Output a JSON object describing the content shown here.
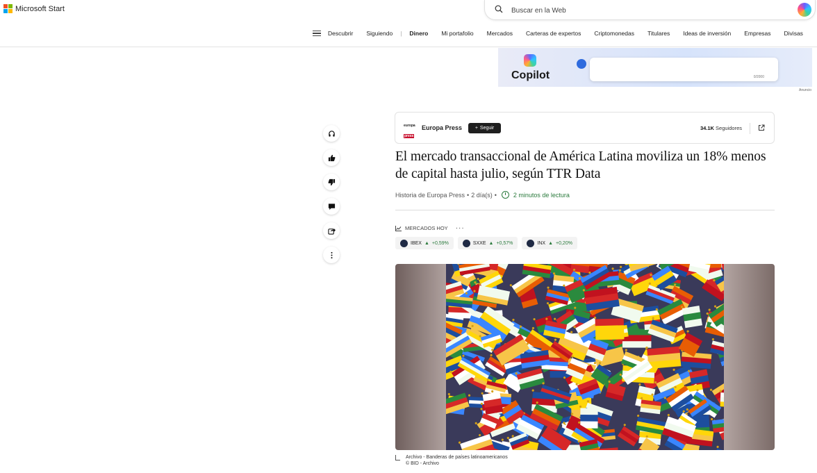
{
  "brand": {
    "name": "Microsoft Start"
  },
  "search": {
    "placeholder": "Buscar en la Web"
  },
  "nav": {
    "items": [
      "Descubrir",
      "Siguiendo",
      "Dinero",
      "Mi portafolio",
      "Mercados",
      "Carteras de expertos",
      "Criptomonedas",
      "Titulares",
      "Ideas de inversión",
      "Empresas",
      "Divisas"
    ],
    "active": "Dinero"
  },
  "ad": {
    "product": "Copilot",
    "counter": "0/2000",
    "label": "Anuncio"
  },
  "rail": {
    "icons": [
      "headphones-icon",
      "thumbs-up-icon",
      "thumbs-down-icon",
      "comment-icon",
      "share-icon",
      "more-icon"
    ]
  },
  "publisher": {
    "logo_line1": "europa",
    "logo_line2": "press",
    "name": "Europa Press",
    "follow_label": "Seguir",
    "followers_count": "34.1K",
    "followers_label": "Seguidores"
  },
  "article": {
    "title": "El mercado transaccional de América Latina moviliza un 18% menos de capital hasta julio, según TTR Data",
    "source": "Historia de Europa Press",
    "age": "2 día(s)",
    "read_time": "2 minutos de lectura"
  },
  "markets": {
    "heading": "MERCADOS HOY",
    "tickers": [
      {
        "symbol": "IBEX",
        "change": "+0,59%"
      },
      {
        "symbol": "SXXE",
        "change": "+0,57%"
      },
      {
        "symbol": "INX",
        "change": "+0,20%"
      }
    ],
    "up_color": "#2a7a3c"
  },
  "image": {
    "caption": "Archivo - Banderas de países latinoamericanos",
    "credit": "© BID - Archivo"
  }
}
